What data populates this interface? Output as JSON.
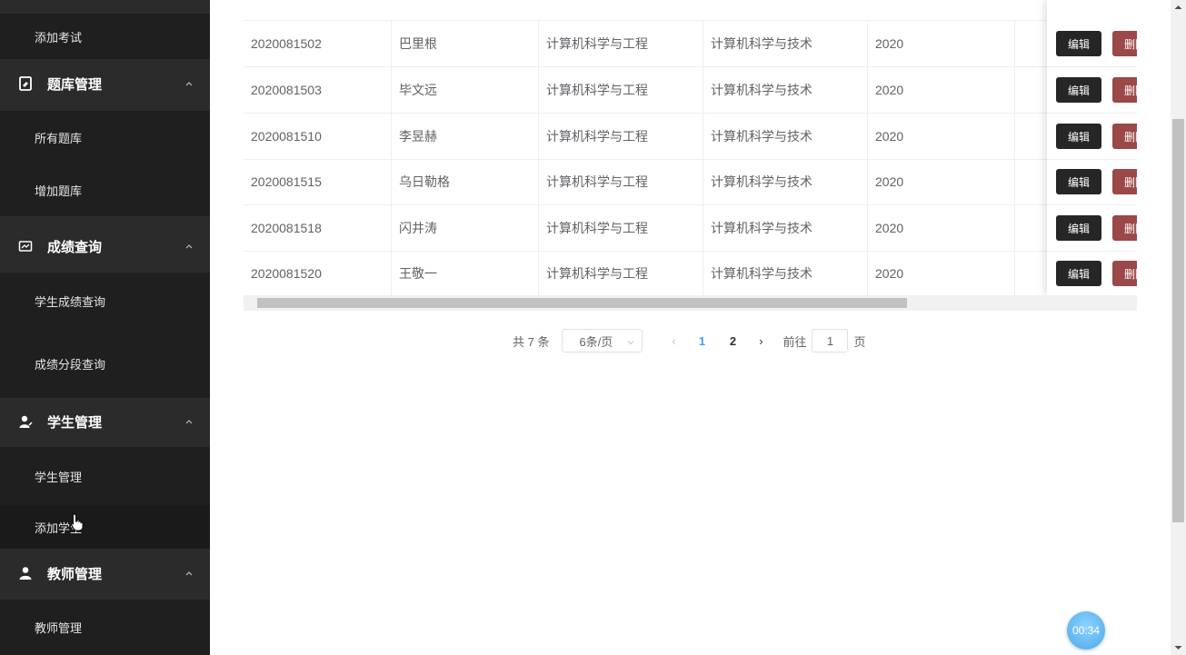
{
  "sidebar": {
    "groups": [
      {
        "type": "item",
        "label": "添加考试"
      },
      {
        "type": "group",
        "label": "题库管理",
        "icon": "document-icon"
      },
      {
        "type": "item",
        "label": "所有题库"
      },
      {
        "type": "item",
        "label": "增加题库"
      },
      {
        "type": "group",
        "label": "成绩查询",
        "icon": "chart-icon"
      },
      {
        "type": "item",
        "label": "学生成绩查询"
      },
      {
        "type": "item",
        "label": "成绩分段查询"
      },
      {
        "type": "group",
        "label": "学生管理",
        "icon": "user-edit-icon"
      },
      {
        "type": "item",
        "label": "学生管理"
      },
      {
        "type": "item",
        "label": "添加学生"
      },
      {
        "type": "group",
        "label": "教师管理",
        "icon": "user-icon"
      },
      {
        "type": "item",
        "label": "教师管理"
      }
    ]
  },
  "table": {
    "rows": [
      {
        "id": "2020081502",
        "name": "巴里根",
        "college": "计算机科学与工程",
        "major": "计算机科学与技术",
        "grade": "2020"
      },
      {
        "id": "2020081503",
        "name": "毕文远",
        "college": "计算机科学与工程",
        "major": "计算机科学与技术",
        "grade": "2020"
      },
      {
        "id": "2020081510",
        "name": "李昱赫",
        "college": "计算机科学与工程",
        "major": "计算机科学与技术",
        "grade": "2020"
      },
      {
        "id": "2020081515",
        "name": "乌日勒格",
        "college": "计算机科学与工程",
        "major": "计算机科学与技术",
        "grade": "2020"
      },
      {
        "id": "2020081518",
        "name": "闪井涛",
        "college": "计算机科学与工程",
        "major": "计算机科学与技术",
        "grade": "2020"
      },
      {
        "id": "2020081520",
        "name": "王敬一",
        "college": "计算机科学与工程",
        "major": "计算机科学与技术",
        "grade": "2020"
      }
    ],
    "edit_label": "编辑",
    "delete_label": "删除"
  },
  "pager": {
    "total": "共 7 条",
    "page_size": "6条/页",
    "pages": [
      "1",
      "2"
    ],
    "current": "1",
    "jump_prefix": "前往",
    "jump_value": "1",
    "jump_suffix": "页"
  },
  "timer": "00:34",
  "colors": {
    "sidebar": "#2b2b2b",
    "edit": "#262626",
    "delete": "#9b4848",
    "active_page": "#409eff"
  }
}
